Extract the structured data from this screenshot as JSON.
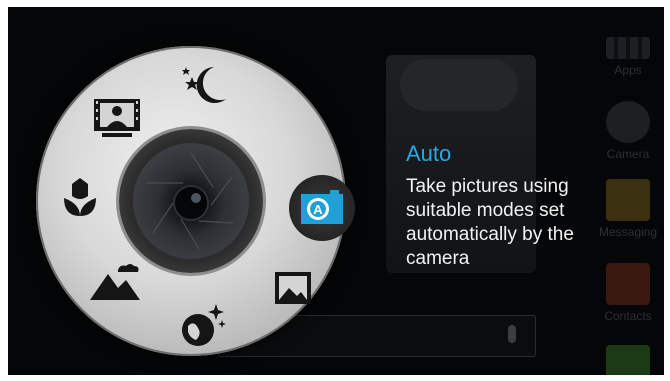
{
  "background": {
    "dock": [
      {
        "label": "Apps",
        "icon": "apps-grid-icon"
      },
      {
        "label": "Camera",
        "icon": "camera-icon"
      },
      {
        "label": "Messaging",
        "icon": "messaging-icon"
      },
      {
        "label": "Contacts",
        "icon": "contacts-icon"
      },
      {
        "label": "",
        "icon": "phone-icon"
      }
    ]
  },
  "mode_dial": {
    "modes": [
      {
        "name": "night",
        "icon": "night-mode-icon"
      },
      {
        "name": "portrait",
        "icon": "portrait-mode-icon"
      },
      {
        "name": "macro",
        "icon": "macro-mode-icon"
      },
      {
        "name": "landscape",
        "icon": "landscape-mode-icon"
      },
      {
        "name": "scenery",
        "icon": "scenery-mode-icon"
      },
      {
        "name": "gallery",
        "icon": "gallery-icon"
      },
      {
        "name": "auto",
        "icon": "auto-mode-icon",
        "selected": true
      }
    ]
  },
  "selected_mode": {
    "title": "Auto",
    "description": "Take pictures using suitable modes set automatically by the camera"
  },
  "colors": {
    "accent": "#2aa7e0",
    "text": "#f2f2f2"
  }
}
